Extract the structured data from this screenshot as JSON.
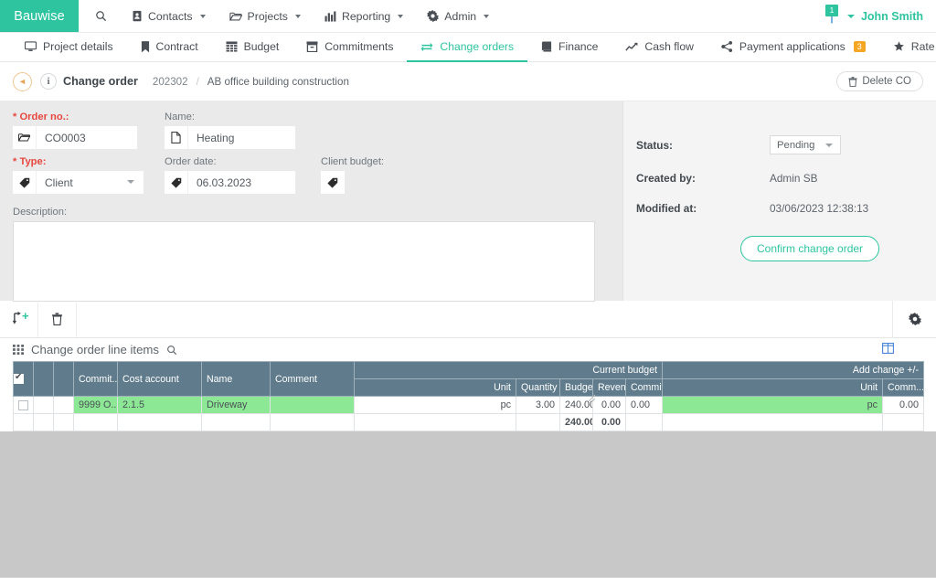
{
  "brand": "Bauwise",
  "topnav": {
    "items": [
      {
        "label": "",
        "icon": "search-icon",
        "has_caret": false
      },
      {
        "label": "Contacts",
        "icon": "contacts-icon",
        "has_caret": true
      },
      {
        "label": "Projects",
        "icon": "folder-icon",
        "has_caret": true
      },
      {
        "label": "Reporting",
        "icon": "chart-bar-icon",
        "has_caret": true
      },
      {
        "label": "Admin",
        "icon": "gear-icon",
        "has_caret": true
      }
    ],
    "notification_count": "1",
    "user_name": "John Smith"
  },
  "tabs": [
    {
      "label": "Project details",
      "icon": "monitor-icon",
      "active": false,
      "badge": ""
    },
    {
      "label": "Contract",
      "icon": "bookmark-icon",
      "active": false,
      "badge": ""
    },
    {
      "label": "Budget",
      "icon": "table-icon",
      "active": false,
      "badge": ""
    },
    {
      "label": "Commitments",
      "icon": "archive-icon",
      "active": false,
      "badge": ""
    },
    {
      "label": "Change orders",
      "icon": "exchange-icon",
      "active": true,
      "badge": ""
    },
    {
      "label": "Finance",
      "icon": "book-icon",
      "active": false,
      "badge": ""
    },
    {
      "label": "Cash flow",
      "icon": "line-chart-icon",
      "active": false,
      "badge": ""
    },
    {
      "label": "Payment applications",
      "icon": "share-icon",
      "active": false,
      "badge": "3"
    },
    {
      "label": "Rate contractors",
      "icon": "star-icon",
      "active": false,
      "badge": ""
    }
  ],
  "breadcrumb": {
    "title": "Change order",
    "id": "202302",
    "separator": "/",
    "project": "AB office building construction",
    "delete_label": "Delete CO"
  },
  "form": {
    "order_no_label": "* Order no.:",
    "order_no_value": "CO0003",
    "name_label": "Name:",
    "name_value": "Heating",
    "type_label": "* Type:",
    "type_value": "Client",
    "order_date_label": "Order date:",
    "order_date_value": "06.03.2023",
    "client_budget_label": "Client budget:",
    "client_budget_value": "",
    "description_label": "Description:",
    "description_value": ""
  },
  "side": {
    "status_label": "Status:",
    "status_value": "Pending",
    "created_by_label": "Created by:",
    "created_by_value": "Admin SB",
    "modified_at_label": "Modified at:",
    "modified_at_value": "03/06/2023 12:38:13",
    "confirm_label": "Confirm change order"
  },
  "toolbar": {
    "add_row_icon": "add-row-icon",
    "delete_row_icon": "trash-icon",
    "settings_icon": "gear-icon"
  },
  "grid": {
    "title": "Change order line items",
    "search_icon": "search-icon",
    "split_icon": "split-columns-icon",
    "group_headers": [
      {
        "label": "",
        "span": 6
      },
      {
        "label": "Current budget",
        "span": 5
      },
      {
        "label": "Add change +/-",
        "span": 2
      }
    ],
    "columns": [
      {
        "label": "",
        "align": "center"
      },
      {
        "label": "",
        "align": "left"
      },
      {
        "label": "",
        "align": "left"
      },
      {
        "label": "Commit...",
        "align": "left"
      },
      {
        "label": "Cost account",
        "align": "left"
      },
      {
        "label": "Name",
        "align": "left"
      },
      {
        "label": "Comment",
        "align": "left"
      },
      {
        "label": "Unit",
        "align": "right"
      },
      {
        "label": "Quantity",
        "align": "right"
      },
      {
        "label": "Budget",
        "align": "right"
      },
      {
        "label": "Revenue",
        "align": "right"
      },
      {
        "label": "Commit...",
        "align": "left"
      },
      {
        "label": "Unit",
        "align": "right"
      },
      {
        "label": "Comm...",
        "align": "right"
      }
    ],
    "rows": [
      {
        "selected": false,
        "commitment": "9999 O...",
        "cost_account": "2.1.5",
        "name": "Driveway",
        "comment": "",
        "unit": "pc",
        "quantity": "3.00",
        "budget": "240.00",
        "revenue": "0.00",
        "commit_amount": "0.00",
        "change_unit": "pc",
        "change_comm": "0.00"
      }
    ],
    "totals": {
      "budget": "240.00",
      "revenue": "0.00"
    }
  },
  "colors": {
    "brand_teal": "#2ec4a0",
    "grid_header": "#5f7b8c",
    "row_highlight": "#8ce895",
    "badge_orange": "#f5a623",
    "required_red": "#e8473f"
  }
}
